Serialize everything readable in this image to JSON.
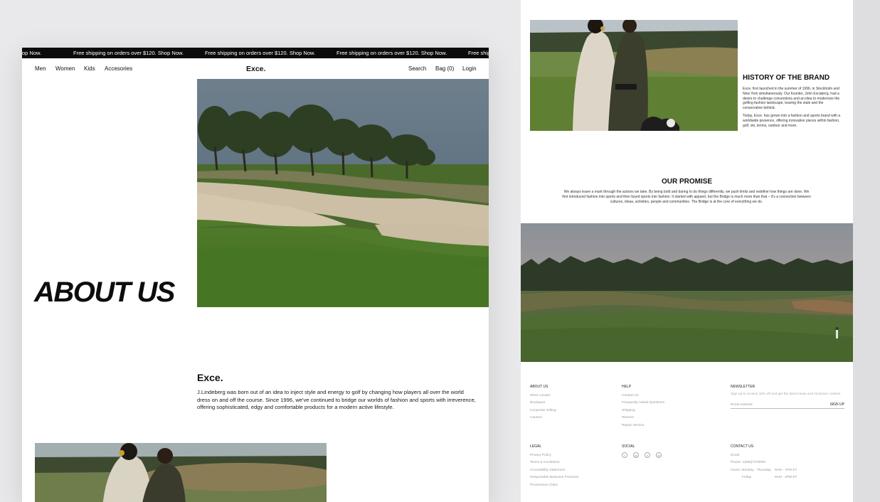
{
  "promo": {
    "first": "op Now.",
    "messages": [
      "Free shipping on orders over $120. Shop Now.",
      "Free shipping on orders over $120. Shop Now.",
      "Free shipping on orders over $120. Shop Now."
    ],
    "last": "Free ship"
  },
  "nav": {
    "links": [
      "Men",
      "Women",
      "Kids",
      "Accesories"
    ],
    "logo": "Exce.",
    "search": "Search",
    "bag": "Bag (0)",
    "login": "Login"
  },
  "hero": {
    "title": "ABOUT US"
  },
  "intro": {
    "brand": "Exce.",
    "text": "J.Lindeberg was born out of an idea to inject style and energy to golf by changing how players all over the world dress on and off the course. Since 1996, we've continued to bridge our worlds of fashion and sports with irreverence, offering sophisticated, edgy and comfortable products for a modern active lifestyle."
  },
  "history": {
    "title": "HISTORY OF THE BRAND",
    "p1": "Exce. first launched in the summer of 1996, in Stockholm and New York simultaneously. Our founder, John Excaberg, had a desire to challenge conventions and an idea to modernize the golfing fashion landscape, leaving the stale and the conservative behind.",
    "p2": "Today, Exce. has grown into a fashion and sports brand with a worldwide presence, offering innovative pieces within fashion, golf, ski, tennis, outdoor and more."
  },
  "promise": {
    "title": "OUR PROMISE",
    "text": "We always leave a mark through the actions we take. By being bold and daring to do things differently, we push limits and redefine how things are done. We first introduced fashion into sports and then fused sports into fashion. It started with apparel, but the Bridge is much more than that – it's a connection between cultures, ideas, activities, people and communities. The Bridge is at the core of everything we do."
  },
  "footer": {
    "about": {
      "heading": "ABOUT US",
      "items": [
        "Store Locator",
        "Boutiques",
        "Corporate Gifting",
        "Careers"
      ]
    },
    "help": {
      "heading": "HELP",
      "items": [
        "Contact Us",
        "Frequently Asked Questions",
        "Shipping",
        "Returns",
        "Repair Service"
      ]
    },
    "newsletter": {
      "heading": "NEWSLETTER",
      "desc": "Sign up to receive 10% off and get the latest news and exclusive content",
      "placeholder": "Email Address",
      "button": "SIGN UP"
    },
    "legal": {
      "heading": "LEGAL",
      "items": [
        "Privacy Policy",
        "Terms & Conditions",
        "Accessibility Statement",
        "Responsible Business Practices",
        "Provenance Claim"
      ]
    },
    "social": {
      "heading": "SOCIAL",
      "icons": [
        "f",
        "ig",
        "x",
        "yt"
      ]
    },
    "contact": {
      "heading": "CONTACT US",
      "email": "Email",
      "phone": "Phone: 1(555)7278093",
      "hours1_day": "Hours: Monday - Thursday",
      "hours1_time": "9AM - 7PM ET",
      "hours2_day": "Friday",
      "hours2_time": "9AM - 2PM ET"
    }
  },
  "colors": {
    "promo_bg": "#0b0b0b",
    "page_bg": "#e9e9eb",
    "text": "#111111",
    "muted": "#999999"
  }
}
